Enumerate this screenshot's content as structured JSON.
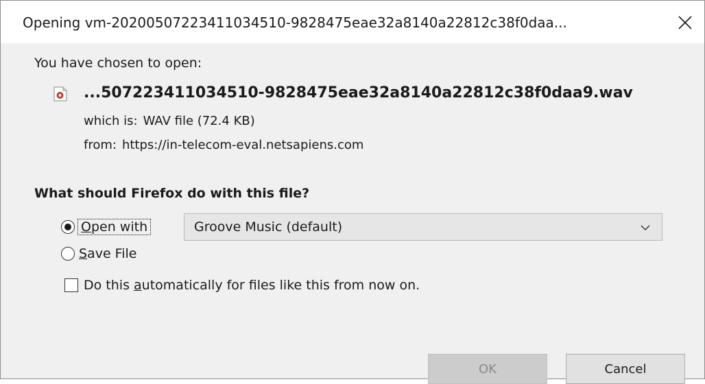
{
  "window": {
    "title": "Opening vm-20200507223411034510-9828475eae32a8140a22812c38f0daa..."
  },
  "file": {
    "chosen_label": "You have chosen to open:",
    "name": "...507223411034510-9828475eae32a8140a22812c38f0daa9.wav",
    "icon": "wav-file-icon",
    "which_is_label": "which is:",
    "which_is_value": "WAV file (72.4 KB)",
    "from_label": "from:",
    "from_value": "https://in-telecom-eval.netsapiens.com"
  },
  "action": {
    "question": "What should Firefox do with this file?",
    "open_with_label_mnemonic": "O",
    "open_with_label_rest": "pen with",
    "open_with_selected": true,
    "app_select_value": "Groove Music (default)",
    "save_file_label_mnemonic": "S",
    "save_file_label_rest": "ave File",
    "save_file_selected": false,
    "auto_label_before": "Do this ",
    "auto_label_mnemonic": "a",
    "auto_label_after": "utomatically for files like this from now on.",
    "auto_checked": false
  },
  "buttons": {
    "ok_label": "OK",
    "cancel_label": "Cancel"
  },
  "colors": {
    "content_bg": "#f0f0f0",
    "titlebar_bg": "#ffffff",
    "ok_disabled_text": "#8a8a8a"
  }
}
